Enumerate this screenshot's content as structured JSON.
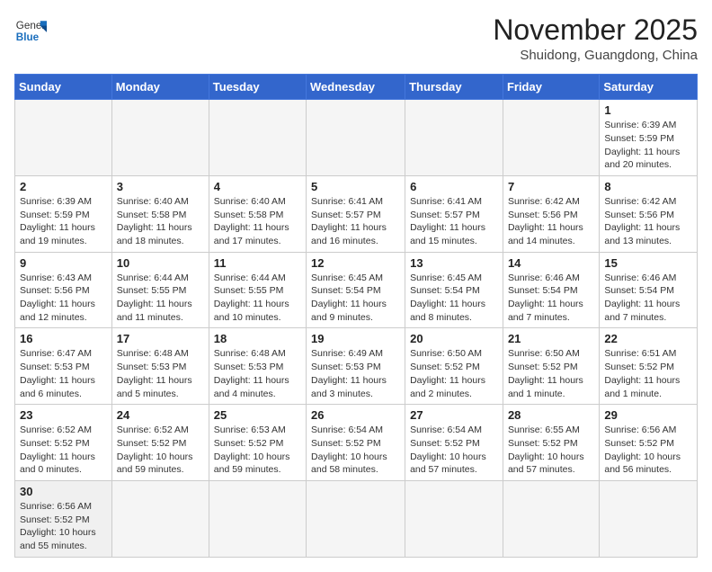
{
  "header": {
    "logo_general": "General",
    "logo_blue": "Blue",
    "month_title": "November 2025",
    "location": "Shuidong, Guangdong, China"
  },
  "weekdays": [
    "Sunday",
    "Monday",
    "Tuesday",
    "Wednesday",
    "Thursday",
    "Friday",
    "Saturday"
  ],
  "weeks": [
    [
      {
        "day": "",
        "info": ""
      },
      {
        "day": "",
        "info": ""
      },
      {
        "day": "",
        "info": ""
      },
      {
        "day": "",
        "info": ""
      },
      {
        "day": "",
        "info": ""
      },
      {
        "day": "",
        "info": ""
      },
      {
        "day": "1",
        "info": "Sunrise: 6:39 AM\nSunset: 5:59 PM\nDaylight: 11 hours\nand 20 minutes."
      }
    ],
    [
      {
        "day": "2",
        "info": "Sunrise: 6:39 AM\nSunset: 5:59 PM\nDaylight: 11 hours\nand 19 minutes."
      },
      {
        "day": "3",
        "info": "Sunrise: 6:40 AM\nSunset: 5:58 PM\nDaylight: 11 hours\nand 18 minutes."
      },
      {
        "day": "4",
        "info": "Sunrise: 6:40 AM\nSunset: 5:58 PM\nDaylight: 11 hours\nand 17 minutes."
      },
      {
        "day": "5",
        "info": "Sunrise: 6:41 AM\nSunset: 5:57 PM\nDaylight: 11 hours\nand 16 minutes."
      },
      {
        "day": "6",
        "info": "Sunrise: 6:41 AM\nSunset: 5:57 PM\nDaylight: 11 hours\nand 15 minutes."
      },
      {
        "day": "7",
        "info": "Sunrise: 6:42 AM\nSunset: 5:56 PM\nDaylight: 11 hours\nand 14 minutes."
      },
      {
        "day": "8",
        "info": "Sunrise: 6:42 AM\nSunset: 5:56 PM\nDaylight: 11 hours\nand 13 minutes."
      }
    ],
    [
      {
        "day": "9",
        "info": "Sunrise: 6:43 AM\nSunset: 5:56 PM\nDaylight: 11 hours\nand 12 minutes."
      },
      {
        "day": "10",
        "info": "Sunrise: 6:44 AM\nSunset: 5:55 PM\nDaylight: 11 hours\nand 11 minutes."
      },
      {
        "day": "11",
        "info": "Sunrise: 6:44 AM\nSunset: 5:55 PM\nDaylight: 11 hours\nand 10 minutes."
      },
      {
        "day": "12",
        "info": "Sunrise: 6:45 AM\nSunset: 5:54 PM\nDaylight: 11 hours\nand 9 minutes."
      },
      {
        "day": "13",
        "info": "Sunrise: 6:45 AM\nSunset: 5:54 PM\nDaylight: 11 hours\nand 8 minutes."
      },
      {
        "day": "14",
        "info": "Sunrise: 6:46 AM\nSunset: 5:54 PM\nDaylight: 11 hours\nand 7 minutes."
      },
      {
        "day": "15",
        "info": "Sunrise: 6:46 AM\nSunset: 5:54 PM\nDaylight: 11 hours\nand 7 minutes."
      }
    ],
    [
      {
        "day": "16",
        "info": "Sunrise: 6:47 AM\nSunset: 5:53 PM\nDaylight: 11 hours\nand 6 minutes."
      },
      {
        "day": "17",
        "info": "Sunrise: 6:48 AM\nSunset: 5:53 PM\nDaylight: 11 hours\nand 5 minutes."
      },
      {
        "day": "18",
        "info": "Sunrise: 6:48 AM\nSunset: 5:53 PM\nDaylight: 11 hours\nand 4 minutes."
      },
      {
        "day": "19",
        "info": "Sunrise: 6:49 AM\nSunset: 5:53 PM\nDaylight: 11 hours\nand 3 minutes."
      },
      {
        "day": "20",
        "info": "Sunrise: 6:50 AM\nSunset: 5:52 PM\nDaylight: 11 hours\nand 2 minutes."
      },
      {
        "day": "21",
        "info": "Sunrise: 6:50 AM\nSunset: 5:52 PM\nDaylight: 11 hours\nand 1 minute."
      },
      {
        "day": "22",
        "info": "Sunrise: 6:51 AM\nSunset: 5:52 PM\nDaylight: 11 hours\nand 1 minute."
      }
    ],
    [
      {
        "day": "23",
        "info": "Sunrise: 6:52 AM\nSunset: 5:52 PM\nDaylight: 11 hours\nand 0 minutes."
      },
      {
        "day": "24",
        "info": "Sunrise: 6:52 AM\nSunset: 5:52 PM\nDaylight: 10 hours\nand 59 minutes."
      },
      {
        "day": "25",
        "info": "Sunrise: 6:53 AM\nSunset: 5:52 PM\nDaylight: 10 hours\nand 59 minutes."
      },
      {
        "day": "26",
        "info": "Sunrise: 6:54 AM\nSunset: 5:52 PM\nDaylight: 10 hours\nand 58 minutes."
      },
      {
        "day": "27",
        "info": "Sunrise: 6:54 AM\nSunset: 5:52 PM\nDaylight: 10 hours\nand 57 minutes."
      },
      {
        "day": "28",
        "info": "Sunrise: 6:55 AM\nSunset: 5:52 PM\nDaylight: 10 hours\nand 57 minutes."
      },
      {
        "day": "29",
        "info": "Sunrise: 6:56 AM\nSunset: 5:52 PM\nDaylight: 10 hours\nand 56 minutes."
      }
    ],
    [
      {
        "day": "30",
        "info": "Sunrise: 6:56 AM\nSunset: 5:52 PM\nDaylight: 10 hours\nand 55 minutes."
      },
      {
        "day": "",
        "info": ""
      },
      {
        "day": "",
        "info": ""
      },
      {
        "day": "",
        "info": ""
      },
      {
        "day": "",
        "info": ""
      },
      {
        "day": "",
        "info": ""
      },
      {
        "day": "",
        "info": ""
      }
    ]
  ]
}
